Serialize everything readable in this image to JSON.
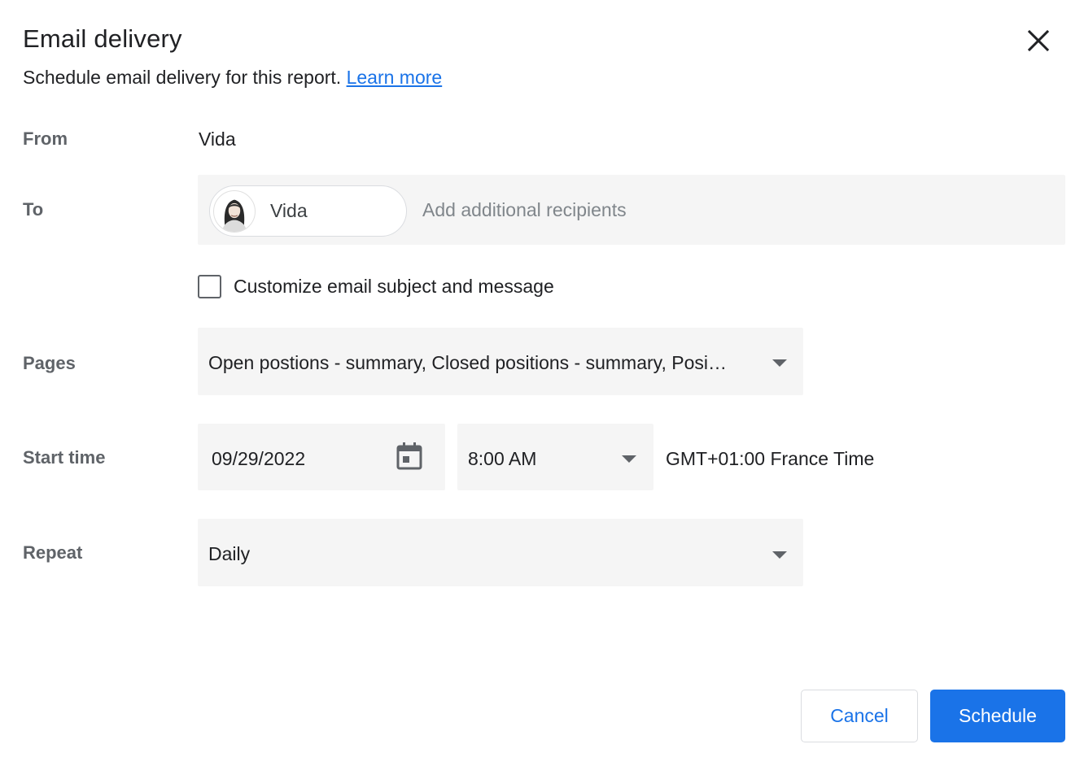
{
  "dialog": {
    "title": "Email delivery",
    "subtitle": "Schedule email delivery for this report.",
    "learn_more": "Learn more"
  },
  "form": {
    "from_label": "From",
    "from_value": "Vida",
    "to_label": "To",
    "recipient_chip": "Vida",
    "recipients_placeholder": "Add additional recipients",
    "customize_label": "Customize email subject and message",
    "customize_checked": false,
    "pages_label": "Pages",
    "pages_value": "Open postions - summary, Closed positions - summary, Posi…",
    "start_time_label": "Start time",
    "start_date": "09/29/2022",
    "start_time": "8:00 AM",
    "timezone": "GMT+01:00 France Time",
    "repeat_label": "Repeat",
    "repeat_value": "Daily"
  },
  "actions": {
    "cancel": "Cancel",
    "schedule": "Schedule"
  },
  "colors": {
    "accent": "#1a73e8",
    "field_bg": "#f5f5f5",
    "label": "#5f6368"
  },
  "icons": [
    "close-icon",
    "avatar",
    "calendar-icon",
    "dropdown-caret-icon"
  ]
}
